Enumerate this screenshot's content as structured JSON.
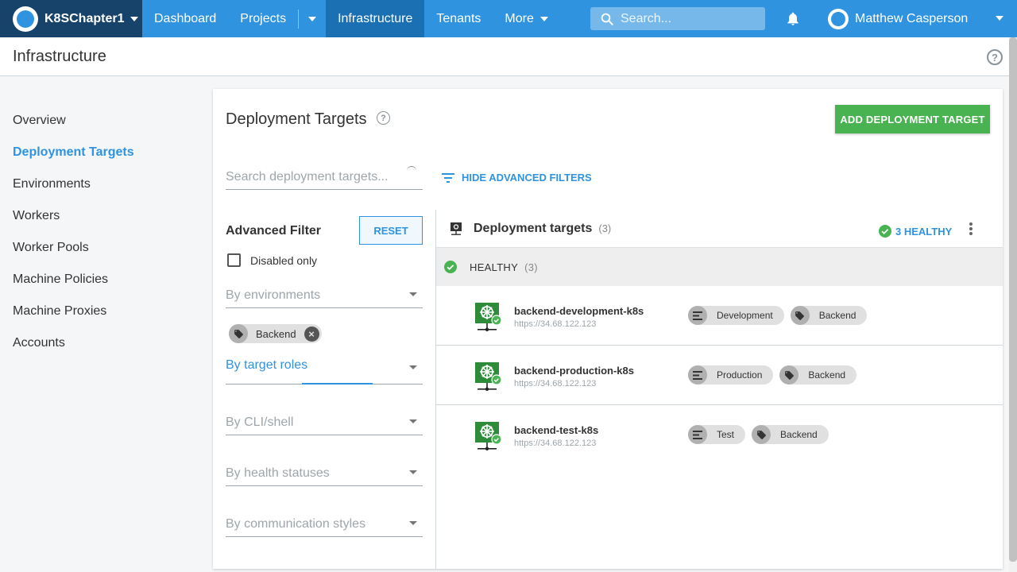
{
  "nav": {
    "space": "K8SChapter1",
    "items": [
      {
        "label": "Dashboard"
      },
      {
        "label": "Projects"
      },
      {
        "label": "Infrastructure"
      },
      {
        "label": "Tenants"
      },
      {
        "label": "More"
      }
    ],
    "search_placeholder": "Search...",
    "user": "Matthew Casperson",
    "colors": {
      "bar": "#2f93e0",
      "active": "#1b6fb3",
      "space": "#17436a"
    }
  },
  "page": {
    "title": "Infrastructure",
    "help_icon": "question-circle-icon"
  },
  "sidebar": {
    "items": [
      {
        "label": "Overview"
      },
      {
        "label": "Deployment Targets",
        "active": true
      },
      {
        "label": "Environments"
      },
      {
        "label": "Workers"
      },
      {
        "label": "Worker Pools"
      },
      {
        "label": "Machine Policies"
      },
      {
        "label": "Machine Proxies"
      },
      {
        "label": "Accounts"
      }
    ]
  },
  "main": {
    "title": "Deployment Targets",
    "add_button": "ADD DEPLOYMENT TARGET",
    "search_placeholder": "Search deployment targets...",
    "hide_filters": "HIDE ADVANCED FILTERS",
    "filter": {
      "title": "Advanced Filter",
      "reset": "RESET",
      "disabled_only": "Disabled only",
      "environments_placeholder": "By environments",
      "selected_role": "Backend",
      "roles_placeholder": "By target roles",
      "cli_placeholder": "By CLI/shell",
      "health_placeholder": "By health statuses",
      "comm_placeholder": "By communication styles"
    },
    "list": {
      "title": "Deployment targets",
      "count": "(3)",
      "healthy_summary": "3 HEALTHY",
      "group": {
        "label": "HEALTHY",
        "count": "(3)"
      },
      "targets": [
        {
          "name": "backend-development-k8s",
          "url": "https://34.68.122.123",
          "environment": "Development",
          "role": "Backend"
        },
        {
          "name": "backend-production-k8s",
          "url": "https://34.68.122.123",
          "environment": "Production",
          "role": "Backend"
        },
        {
          "name": "backend-test-k8s",
          "url": "https://34.68.122.123",
          "environment": "Test",
          "role": "Backend"
        }
      ]
    },
    "colors": {
      "add_button": "#48b350",
      "healthy": "#48b350",
      "link": "#2f93e0"
    }
  }
}
